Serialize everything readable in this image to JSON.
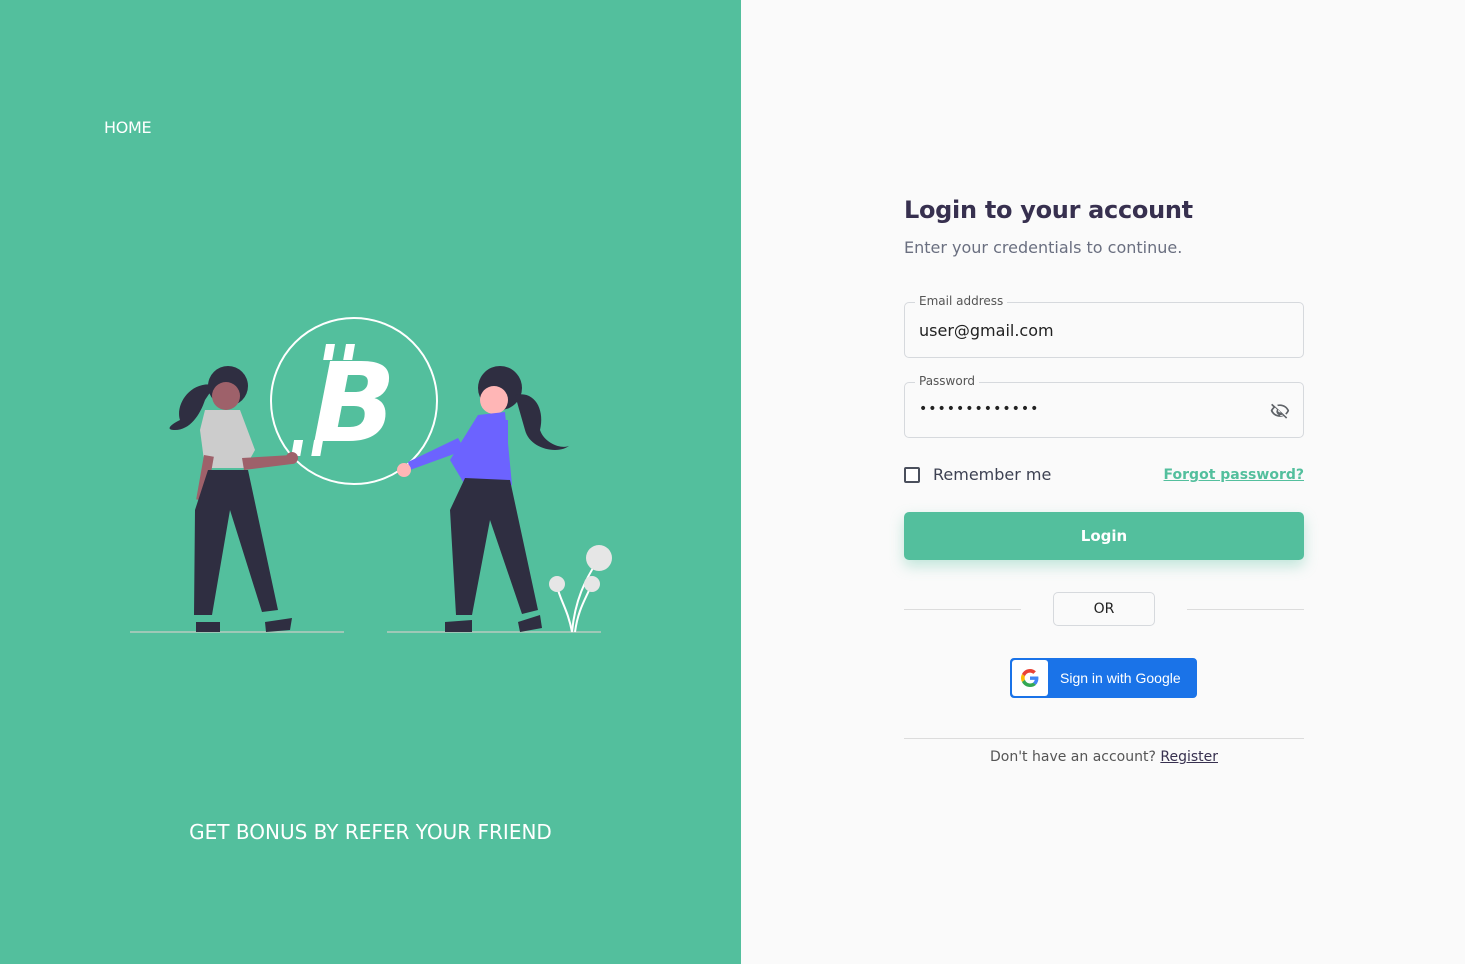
{
  "left": {
    "home_label": "HOME",
    "promo_text": "GET BONUS BY REFER YOUR FRIEND",
    "background_color": "#53bf9d"
  },
  "form": {
    "title": "Login to your account",
    "subtitle": "Enter your credentials to continue.",
    "email": {
      "label": "Email address",
      "value": "user@gmail.com"
    },
    "password": {
      "label": "Password",
      "value": "•••••••••••••",
      "toggle_icon": "eye-off-icon"
    },
    "remember_label": "Remember me",
    "remember_checked": false,
    "forgot_label": "Forgot password?",
    "login_label": "Login",
    "or_label": "OR",
    "google_label": "Sign in with Google",
    "no_account_text": "Don't have an account?",
    "register_label": "Register"
  },
  "colors": {
    "accent": "#53bf9d",
    "title": "#37304f",
    "google_blue": "#1a73e8"
  }
}
